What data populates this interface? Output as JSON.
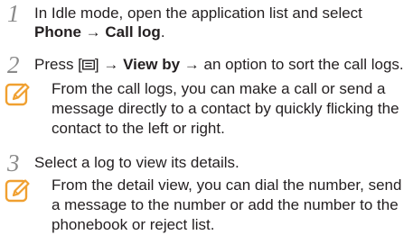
{
  "steps": [
    {
      "number": "1",
      "lines": [
        {
          "text": "In Idle mode, open the application list and select"
        },
        {
          "bold1": "Phone",
          "arrow": " → ",
          "bold2": "Call log",
          "tail": "."
        }
      ]
    },
    {
      "number": "2",
      "pre": "Press [",
      "post": "] → ",
      "bold": "View by",
      "tail": " → an option to sort the call logs."
    },
    {
      "number": "3",
      "text": "Select a log to view its details."
    }
  ],
  "notes": [
    {
      "icon": "note-pencil-icon",
      "lines": [
        "From the call logs, you can make a call or send a",
        "message directly to a contact by quickly flicking the",
        "contact to the left or right."
      ]
    },
    {
      "icon": "note-pencil-icon",
      "lines": [
        "From the detail view, you can dial the number, send",
        "a message to the number or add the number to the",
        "phonebook or reject list."
      ]
    }
  ],
  "colors": {
    "text": "#231f20",
    "step_number": "#8a8a8a",
    "note_icon": "#f0a030"
  }
}
